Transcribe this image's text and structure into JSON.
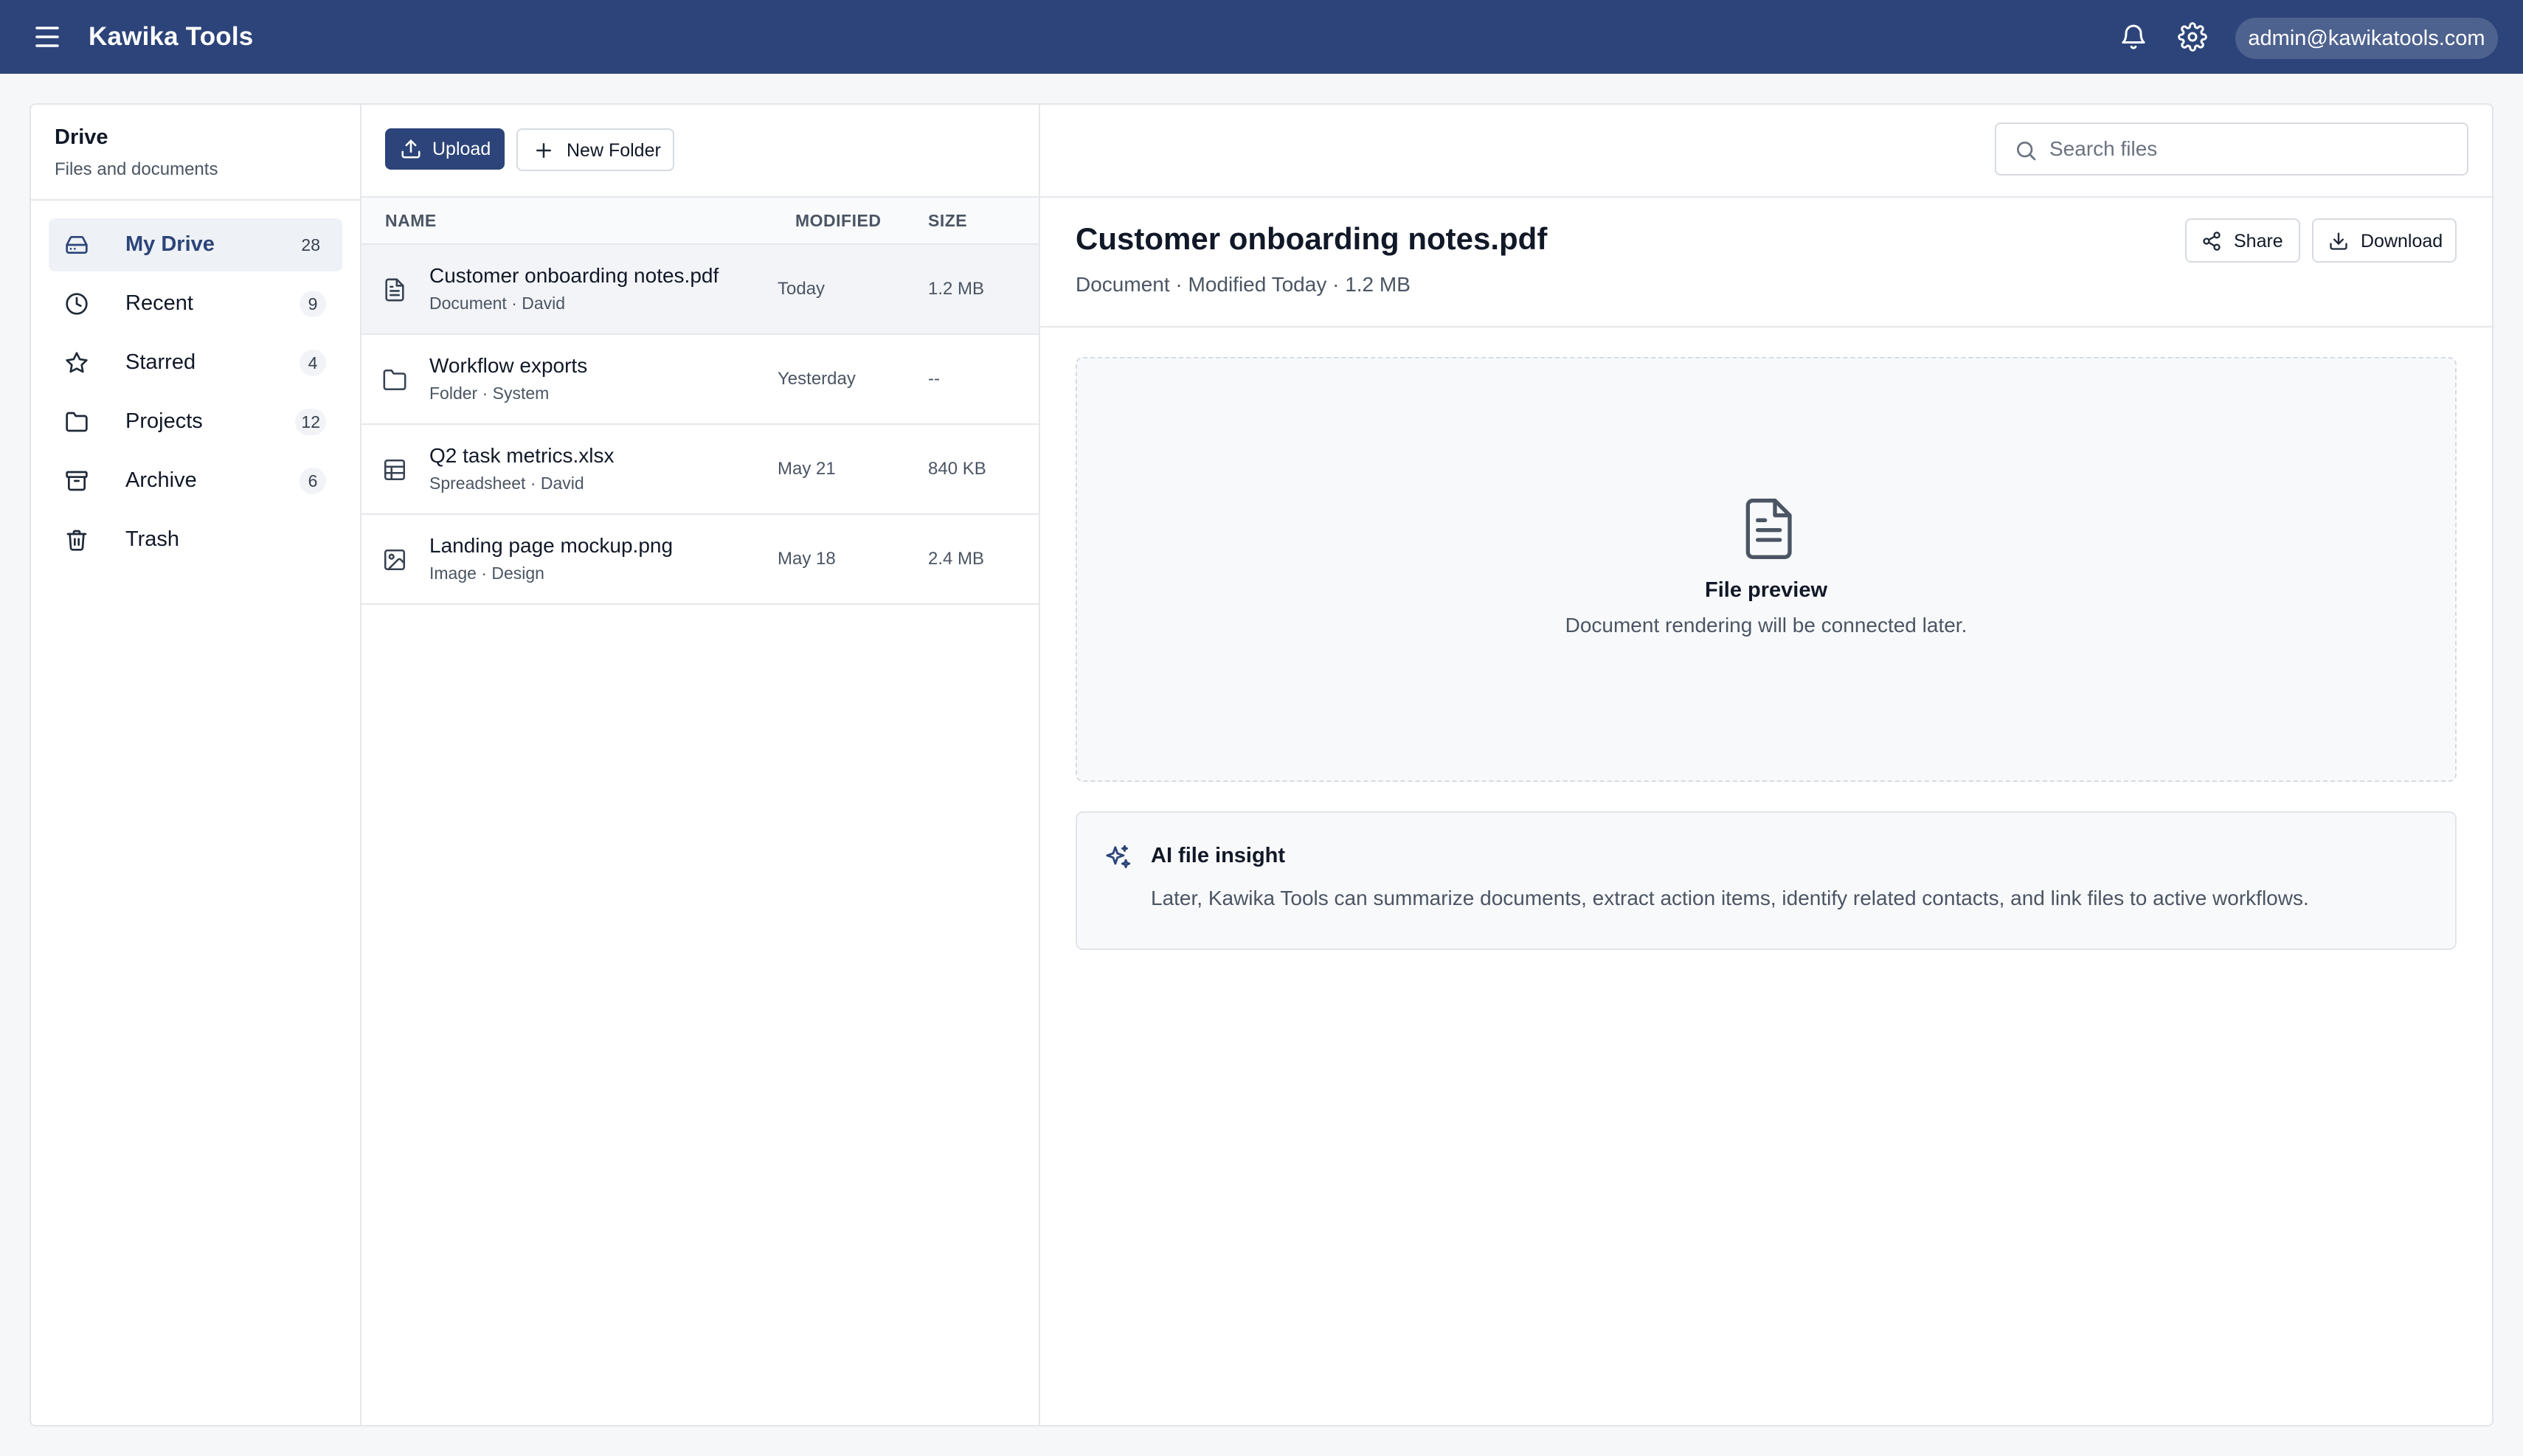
{
  "app": {
    "title": "Kawika Tools",
    "account": "admin@kawikatools.com",
    "brand_color": "#2c4479"
  },
  "sidebar": {
    "title": "Drive",
    "subtitle": "Files and documents",
    "items": [
      {
        "label": "My Drive",
        "count": "28",
        "icon": "drive-icon",
        "active": true
      },
      {
        "label": "Recent",
        "count": "9",
        "icon": "clock-icon"
      },
      {
        "label": "Starred",
        "count": "4",
        "icon": "star-icon"
      },
      {
        "label": "Projects",
        "count": "12",
        "icon": "folder-icon"
      },
      {
        "label": "Archive",
        "count": "6",
        "icon": "archive-icon"
      },
      {
        "label": "Trash",
        "count": "",
        "icon": "trash-icon"
      }
    ]
  },
  "toolbar": {
    "upload_label": "Upload",
    "new_folder_label": "New Folder",
    "search_placeholder": "Search files"
  },
  "file_table": {
    "columns": [
      "NAME",
      "MODIFIED",
      "SIZE"
    ],
    "rows": [
      {
        "name": "Customer onboarding notes.pdf",
        "meta": "Document · David",
        "modified": "Today",
        "size": "1.2 MB",
        "icon": "document-icon",
        "selected": true
      },
      {
        "name": "Workflow exports",
        "meta": "Folder · System",
        "modified": "Yesterday",
        "size": "--",
        "icon": "folder-icon"
      },
      {
        "name": "Q2 task metrics.xlsx",
        "meta": "Spreadsheet · David",
        "modified": "May 21",
        "size": "840 KB",
        "icon": "spreadsheet-icon"
      },
      {
        "name": "Landing page mockup.png",
        "meta": "Image · Design",
        "modified": "May 18",
        "size": "2.4 MB",
        "icon": "image-icon"
      }
    ]
  },
  "detail": {
    "title": "Customer onboarding notes.pdf",
    "meta": "Document · Modified Today · 1.2 MB",
    "share_label": "Share",
    "download_label": "Download",
    "preview_title": "File preview",
    "preview_text": "Document rendering will be connected later.",
    "insight_title": "AI file insight",
    "insight_text": "Later, Kawika Tools can summarize documents, extract action items, identify related contacts, and link files to active workflows."
  }
}
